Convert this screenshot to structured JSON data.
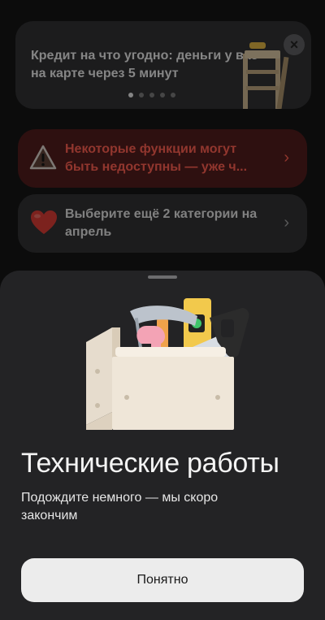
{
  "promo": {
    "text": "Кредит на что угодно: деньги у вас на карте через 5 минут",
    "close_icon": "close-icon",
    "art_icon": "ladder-icon",
    "pager": {
      "count": 5,
      "active_index": 0
    }
  },
  "alert": {
    "icon": "warning-icon",
    "text": "Некоторые функции могут быть недоступны — уже ч...",
    "color": "#ff5a4a",
    "chevron_icon": "chevron-right-icon"
  },
  "categories": {
    "icon": "heart-icon",
    "text": "Выберите ещё 2 категории на апрель",
    "chevron_icon": "chevron-right-icon"
  },
  "sheet": {
    "illustration_icon": "toolbox-icon",
    "title": "Технические работы",
    "subtitle": "Подождите немного — мы скоро закончим",
    "button_label": "Понятно"
  }
}
